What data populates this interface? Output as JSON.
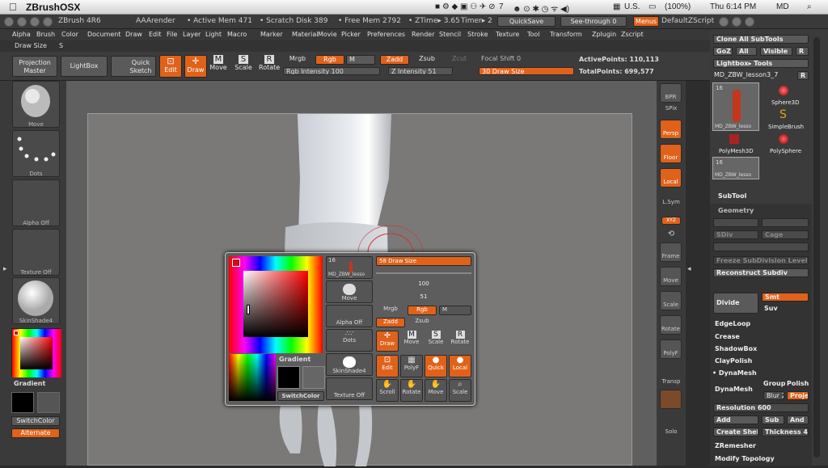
{
  "mac_menubar": {
    "app": "ZBrushOSX",
    "battery": "(100%)",
    "clock": "Thu 6:14 PM",
    "user": "MD",
    "counter": "7",
    "input": "U.S."
  },
  "titlebar": {
    "app": "ZBrush 4R6",
    "render": "AAArender",
    "active_mem": "• Active Mem 471",
    "scratch": "• Scratch Disk 389",
    "free_mem": "• Free Mem 2792",
    "ztime": "• ZTime▸ 3.65",
    "timer": "Timer▸ 2",
    "quicksave": "QuickSave",
    "seethrough": "See-through 0",
    "menus": "Menus",
    "default_script": "DefaultZScript"
  },
  "menu_items": [
    "Alpha",
    "Brush",
    "Color",
    "Document",
    "Draw",
    "Edit",
    "File",
    "Layer",
    "Light",
    "Macro",
    "Marker",
    "Material",
    "Movie",
    "Picker",
    "Preferences",
    "Render",
    "Stencil",
    "Stroke",
    "Texture",
    "Tool",
    "Transform",
    "Zplugin",
    "Zscript"
  ],
  "subbar": {
    "draw_size": "Draw Size",
    "shortcut": "S"
  },
  "toolbar": {
    "projection_master": "Projection Master",
    "lightbox": "LightBox",
    "quick_sketch": "Quick Sketch",
    "edit": "Edit",
    "draw": "Draw",
    "move": "Move",
    "scale": "Scale",
    "rotate": "Rotate",
    "mrgb": "Mrgb",
    "rgb": "Rgb",
    "m": "M",
    "zadd": "Zadd",
    "zsub": "Zsub",
    "zcut": "Zcut",
    "rgb_intensity": "Rgb Intensity 100",
    "z_intensity": "Z Intensity 51",
    "focal_shift": "Focal Shift 0",
    "draw_size": "30 Draw Size",
    "active_points": "ActivePoints: 110,113",
    "total_points": "TotalPoints: 699,577"
  },
  "left_shelf": {
    "brush": "Move",
    "stroke": "Dots",
    "alpha": "Alpha Off",
    "texture": "Texture Off",
    "material": "SkinShade4",
    "gradient": "Gradient",
    "switch_color": "SwitchColor",
    "alternate": "Alternate"
  },
  "right_shelf": {
    "bpr": "BPR",
    "spix": "SPix",
    "persp": "Persp",
    "floor": "Floor",
    "local": "Local",
    "lsym": "L.Sym",
    "xyz": "XYZ",
    "frame": "Frame",
    "move": "Move",
    "scale": "Scale",
    "rotate": "Rotate",
    "polyf": "PolyF",
    "transp": "Transp",
    "solo": "Solo"
  },
  "tool_panel": {
    "clone_all": "Clone All SubTools",
    "goz": "GoZ",
    "all": "All",
    "visible": "Visible",
    "r": "R",
    "lightbox_tools": "Lightbox▸ Tools",
    "current_tool": "MD_ZBW_lesson3_7",
    "count": "16",
    "thumb_name": "MD_ZBW_lesso",
    "sphere3d": "Sphere3D",
    "simplebrush": "SimpleBrush",
    "polymesh3d": "PolyMesh3D",
    "polysphere": "PolySphere",
    "thumb2_name": "MD_ZBW_lesso",
    "count2": "16"
  },
  "subtool_panel": {
    "subtool": "SubTool",
    "geometry": "Geometry",
    "sdiv": "SDiv",
    "cage": "Cage",
    "freeze": "Freeze SubDivision Level",
    "reconstruct": "Reconstruct Subdiv",
    "divide": "Divide",
    "smt": "Smt",
    "suv": "Suv",
    "edgeloop": "EdgeLoop",
    "crease": "Crease",
    "shadowbox": "ShadowBox",
    "claypolish": "ClayPolish",
    "dynamesh_head": "• DynaMesh",
    "dynamesh": "DynaMesh",
    "group": "Group",
    "polish": "Polish",
    "blur": "Blur 2",
    "project": "Proje",
    "resolution": "Resolution 600",
    "add": "Add",
    "sub": "Sub",
    "and": "And",
    "create_shell": "Create Shel",
    "thickness": "Thickness 4",
    "zremesher": "ZRemesher",
    "modify_topology": "Modify Topology"
  },
  "popup": {
    "draw_size": "58 Draw Size",
    "tool_count": "16",
    "tool_name": "MD_ZBW_lesso",
    "brush": "Move",
    "alpha": "Alpha Off",
    "stroke": "Dots",
    "material": "SkinShade4",
    "texture": "Texture Off",
    "gradient": "Gradient",
    "switch_color": "SwitchColor",
    "rgb_intensity": "100",
    "z_intensity": "51",
    "mrgb": "Mrgb",
    "rgb": "Rgb",
    "m": "M",
    "zadd": "Zadd",
    "zsub": "Zsub",
    "draw": "Draw",
    "move": "Move",
    "scale": "Scale",
    "rotate": "Rotate",
    "edit": "Edit",
    "polyf": "PolyF",
    "quick": "Quick",
    "local": "Local",
    "scroll": "Scroll",
    "rotate2": "Rotate",
    "move2": "Move",
    "scale2": "Scale"
  },
  "colors": {
    "accent": "#e0621a",
    "bg": "#3a3a3a"
  }
}
